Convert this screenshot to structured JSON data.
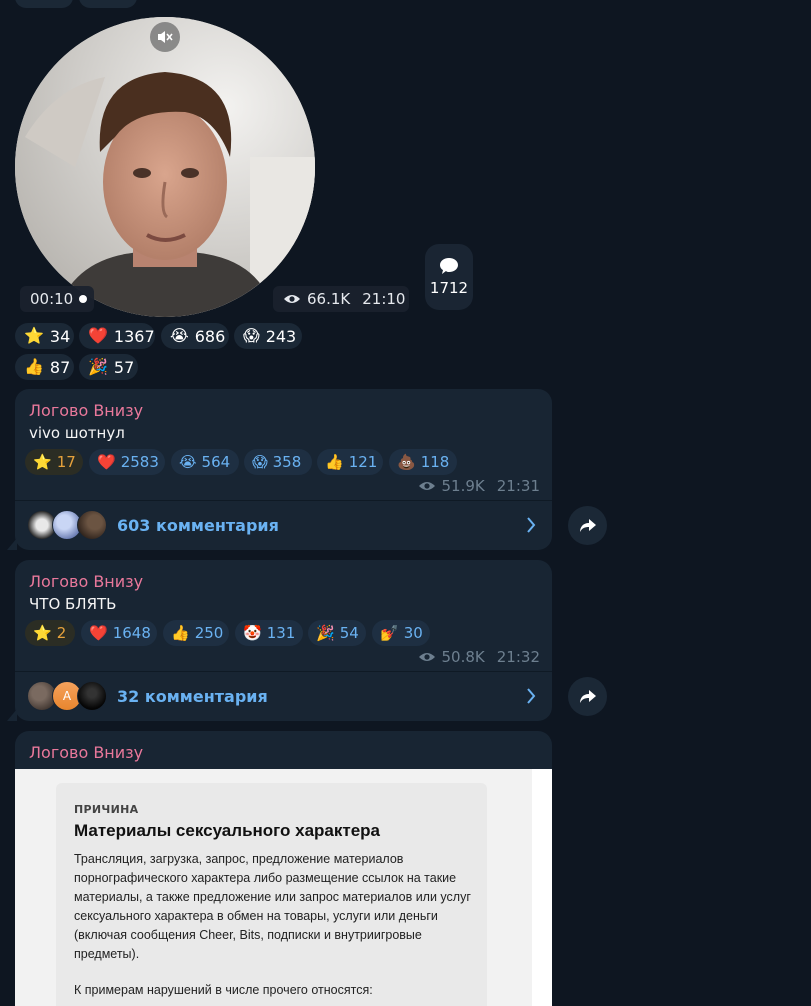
{
  "colors": {
    "background": "#0e1621",
    "bubble": "#182533",
    "sender": "#e9789b",
    "link": "#6ab2f2",
    "meta": "#6d7f8f"
  },
  "video_note": {
    "duration": "00:10",
    "views": "66.1K",
    "time": "21:10",
    "comments_count": "1712",
    "reactions": [
      {
        "emoji": "⭐",
        "icon": "star-icon",
        "count": "34"
      },
      {
        "emoji": "❤️",
        "icon": "heart-icon",
        "count": "1367"
      },
      {
        "emoji": "😭",
        "icon": "crying-face-icon",
        "count": "686"
      },
      {
        "emoji": "😱",
        "icon": "screaming-face-icon",
        "count": "243"
      },
      {
        "emoji": "👍",
        "icon": "thumbs-up-icon",
        "count": "87"
      },
      {
        "emoji": "🎉",
        "icon": "party-popper-icon",
        "count": "57"
      }
    ]
  },
  "messages": [
    {
      "sender": "Логово Внизу",
      "text": "vivo шотнул",
      "reactions": [
        {
          "emoji": "⭐",
          "icon": "star-icon",
          "count": "17"
        },
        {
          "emoji": "❤️",
          "icon": "heart-icon",
          "count": "2583"
        },
        {
          "emoji": "😭",
          "icon": "crying-face-icon",
          "count": "564"
        },
        {
          "emoji": "😱",
          "icon": "screaming-face-icon",
          "count": "358"
        },
        {
          "emoji": "👍",
          "icon": "thumbs-up-icon",
          "count": "121"
        },
        {
          "emoji": "💩",
          "icon": "pile-of-poo-icon",
          "count": "118"
        }
      ],
      "views": "51.9K",
      "time": "21:31",
      "comments": "603 комментария"
    },
    {
      "sender": "Логово Внизу",
      "text": "ЧТО БЛЯТЬ",
      "reactions": [
        {
          "emoji": "⭐",
          "icon": "star-icon",
          "count": "2"
        },
        {
          "emoji": "❤️",
          "icon": "heart-icon",
          "count": "1648"
        },
        {
          "emoji": "👍",
          "icon": "thumbs-up-icon",
          "count": "250"
        },
        {
          "emoji": "🤡",
          "icon": "clown-face-icon",
          "count": "131"
        },
        {
          "emoji": "🎉",
          "icon": "party-popper-icon",
          "count": "54"
        },
        {
          "emoji": "💅",
          "icon": "nail-polish-icon",
          "count": "30"
        }
      ],
      "views": "50.8K",
      "time": "21:32",
      "comments": "32 комментария",
      "avatar_letter": "A"
    },
    {
      "sender": "Логово Внизу",
      "image": {
        "label": "ПРИЧИНА",
        "title": "Материалы сексуального характера",
        "body": "Трансляция, загрузка, запрос, предложение материалов порнографического характера либо размещение ссылок на такие материалы, а также предложение или запрос материалов или услуг сексуального характера в обмен на товары, услуги или деньги (включая сообщения Cheer, Bits, подписки и внутриигровые предметы).",
        "example": "К примерам нарушений в числе прочего относятся:"
      }
    }
  ]
}
